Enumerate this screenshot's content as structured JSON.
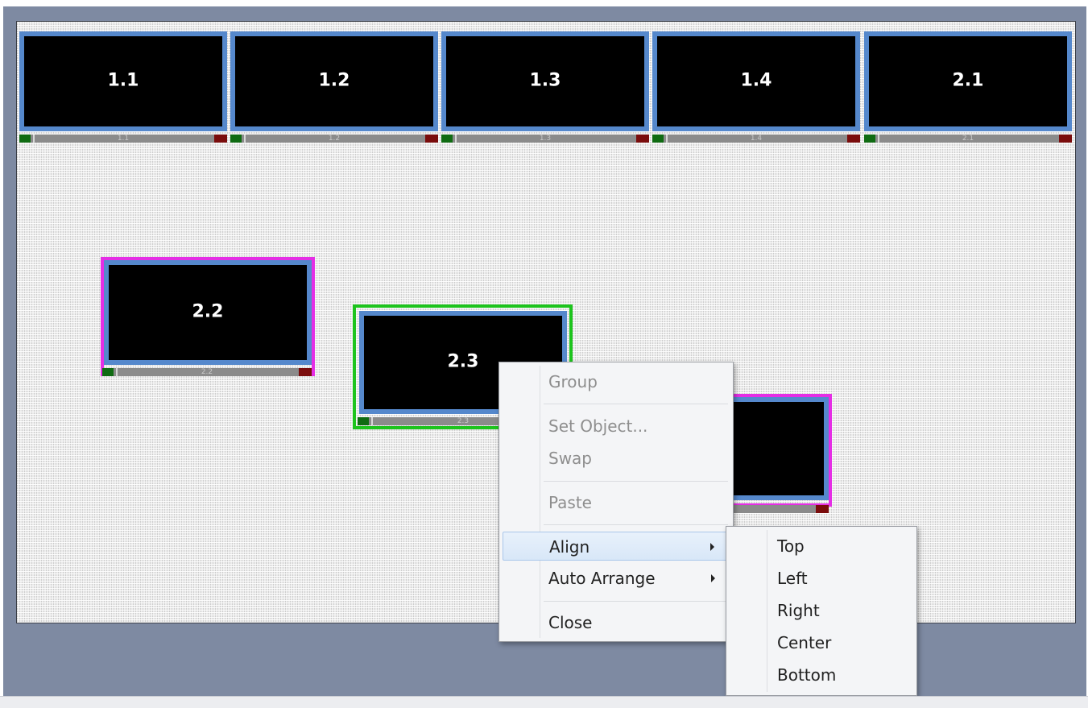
{
  "tiles": [
    {
      "label": "1.1",
      "bar_label": "1.1"
    },
    {
      "label": "1.2",
      "bar_label": "1.2"
    },
    {
      "label": "1.3",
      "bar_label": "1.3"
    },
    {
      "label": "1.4",
      "bar_label": "1.4"
    },
    {
      "label": "2.1",
      "bar_label": "2.1"
    },
    {
      "label": "2.2",
      "bar_label": "2.2"
    },
    {
      "label": "2.3",
      "bar_label": "2.3"
    },
    {
      "label": "",
      "bar_label": ""
    }
  ],
  "context_menu": {
    "group": "Group",
    "set_object": "Set Object...",
    "swap": "Swap",
    "paste": "Paste",
    "align": "Align",
    "auto_arrange": "Auto Arrange",
    "close": "Close"
  },
  "align_submenu": {
    "top": "Top",
    "left": "Left",
    "right": "Right",
    "center": "Center",
    "bottom": "Bottom"
  },
  "colors": {
    "tile_border": "#5588cc",
    "selected_outline": "#1dc41d",
    "group_outline": "#e52ee5",
    "status_green": "#0f6b12",
    "status_red": "#7a0c0c"
  }
}
